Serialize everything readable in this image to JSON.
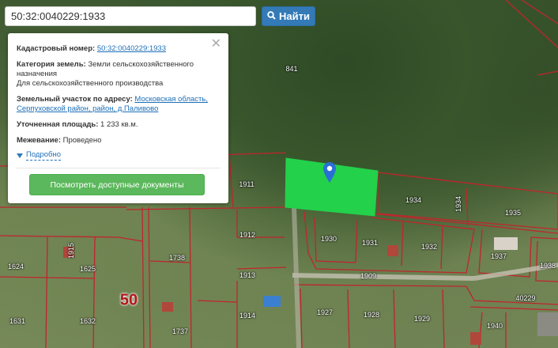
{
  "search": {
    "value": "50:32:0040229:1933",
    "button_label": "Найти",
    "button_icon": "search-icon"
  },
  "popup": {
    "cadastral_label": "Кадастровый номер:",
    "cadastral_value": "50:32:0040229:1933",
    "category_label": "Категория земель:",
    "category_value_1": "Земли сельскохозяйственного назначения",
    "category_value_2": "Для сельскохозяйственного производства",
    "address_label": "Земельный участок по адресу:",
    "address_value": "Московская область, Серпуховской район, район, д.Паливово",
    "area_label": "Уточненная площадь:",
    "area_value": "1 233 кв.м.",
    "survey_label": "Межевание:",
    "survey_value": "Проведено",
    "details_link": "Подробно",
    "docs_button": "Посмотреть доступные документы",
    "close_icon": "close-icon"
  },
  "map": {
    "selected_fill": "#23d14b",
    "boundary_color": "#c0252c",
    "quarter_label": "50",
    "plot_labels": [
      "841",
      "1911",
      "1934",
      "1934",
      "1935",
      "1912",
      "1930",
      "1931",
      "1932",
      "1937",
      "1938",
      "1738",
      "1624",
      "1625",
      "1913",
      "1909",
      "1915",
      "1631",
      "1632",
      "1737",
      "1914",
      "1927",
      "1928",
      "1929",
      "1940",
      "40229"
    ]
  }
}
